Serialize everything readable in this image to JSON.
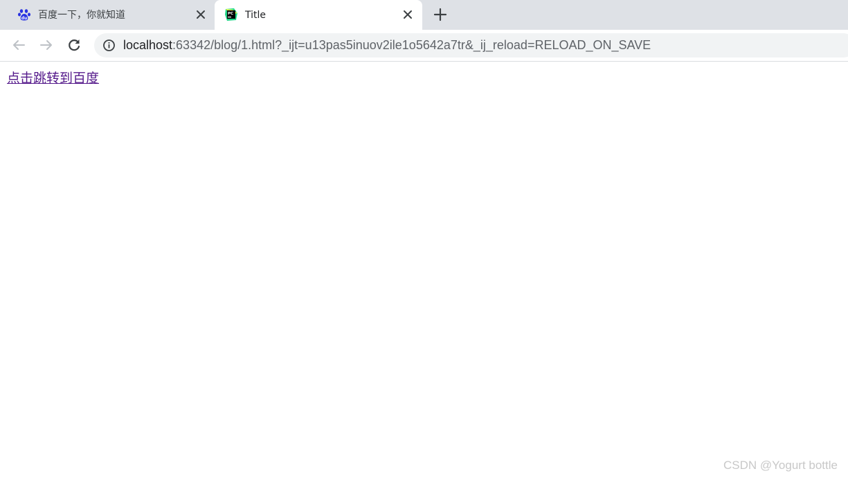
{
  "tabs": [
    {
      "title": "百度一下，你就知道",
      "favicon": "baidu-paw-icon",
      "active": false
    },
    {
      "title": "Title",
      "favicon": "pycharm-icon",
      "active": true
    }
  ],
  "toolbar": {
    "back_icon": "arrow-left-icon",
    "forward_icon": "arrow-right-icon",
    "reload_icon": "reload-icon",
    "site_info_icon": "info-icon"
  },
  "address_bar": {
    "host": "localhost",
    "rest": ":63342/blog/1.html?_ijt=u13pas5inuov2ile1o5642a7tr&_ij_reload=RELOAD_ON_SAVE"
  },
  "page": {
    "link_text": "点击跳转到百度"
  },
  "watermark": "CSDN @Yogurt bottle",
  "colors": {
    "tabstrip_bg": "#dee1e6",
    "omnibox_bg": "#f1f3f4",
    "visited_link": "#551a8b",
    "baidu_blue": "#2932e1"
  }
}
